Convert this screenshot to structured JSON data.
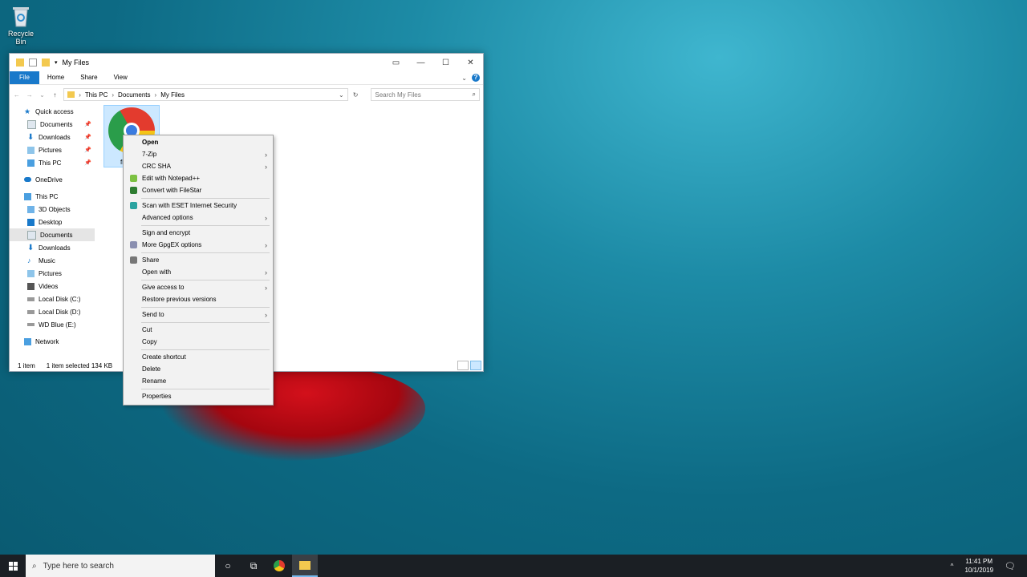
{
  "desktop": {
    "recycle_bin_label": "Recycle Bin"
  },
  "window": {
    "title": "My Files",
    "ribbon_tabs": [
      "File",
      "Home",
      "Share",
      "View"
    ],
    "breadcrumb": [
      "This PC",
      "Documents",
      "My Files"
    ],
    "search_placeholder": "Search My Files",
    "nav": [
      {
        "label": "Quick access",
        "icon": "star-icon",
        "level": 0
      },
      {
        "label": "Documents",
        "icon": "documents-icon",
        "level": 1,
        "pinned": true
      },
      {
        "label": "Downloads",
        "icon": "download-icon",
        "level": 1,
        "pinned": true
      },
      {
        "label": "Pictures",
        "icon": "pictures-icon",
        "level": 1,
        "pinned": true
      },
      {
        "label": "This PC",
        "icon": "computer-icon",
        "level": 1,
        "pinned": true
      },
      {
        "label": "OneDrive",
        "icon": "cloud-icon",
        "level": 0
      },
      {
        "label": "This PC",
        "icon": "computer-icon",
        "level": 0
      },
      {
        "label": "3D Objects",
        "icon": "cube-icon",
        "level": 1
      },
      {
        "label": "Desktop",
        "icon": "desktop-icon",
        "level": 1
      },
      {
        "label": "Documents",
        "icon": "documents-icon",
        "level": 1,
        "selected": true
      },
      {
        "label": "Downloads",
        "icon": "download-icon",
        "level": 1
      },
      {
        "label": "Music",
        "icon": "music-icon",
        "level": 1
      },
      {
        "label": "Pictures",
        "icon": "pictures-icon",
        "level": 1
      },
      {
        "label": "Videos",
        "icon": "video-icon",
        "level": 1
      },
      {
        "label": "Local Disk (C:)",
        "icon": "drive-icon",
        "level": 1
      },
      {
        "label": "Local Disk (D:)",
        "icon": "drive-icon",
        "level": 1
      },
      {
        "label": "WD Blue (E:)",
        "icon": "drive-icon",
        "level": 1
      },
      {
        "label": "Network",
        "icon": "network-icon",
        "level": 0
      }
    ],
    "file": {
      "name": "fi"
    },
    "status": {
      "items": "1 item",
      "selected": "1 item selected  134 KB"
    }
  },
  "context_menu": {
    "items": [
      {
        "label": "Open",
        "bold": true
      },
      {
        "label": "7-Zip",
        "submenu": true
      },
      {
        "label": "CRC SHA",
        "submenu": true
      },
      {
        "label": "Edit with Notepad++",
        "icon": "notepadpp-icon"
      },
      {
        "label": "Convert with FileStar",
        "icon": "filestar-icon"
      },
      {
        "sep": true
      },
      {
        "label": "Scan with ESET Internet Security",
        "icon": "eset-icon"
      },
      {
        "label": "Advanced options",
        "submenu": true
      },
      {
        "sep": true
      },
      {
        "label": "Sign and encrypt"
      },
      {
        "label": "More GpgEX options",
        "icon": "lock-icon",
        "submenu": true
      },
      {
        "sep": true
      },
      {
        "label": "Share",
        "icon": "share-icon"
      },
      {
        "label": "Open with",
        "submenu": true
      },
      {
        "sep": true
      },
      {
        "label": "Give access to",
        "submenu": true
      },
      {
        "label": "Restore previous versions"
      },
      {
        "sep": true
      },
      {
        "label": "Send to",
        "submenu": true
      },
      {
        "sep": true
      },
      {
        "label": "Cut"
      },
      {
        "label": "Copy"
      },
      {
        "sep": true
      },
      {
        "label": "Create shortcut"
      },
      {
        "label": "Delete"
      },
      {
        "label": "Rename"
      },
      {
        "sep": true
      },
      {
        "label": "Properties"
      }
    ]
  },
  "taskbar": {
    "search_placeholder": "Type here to search",
    "time": "11:41 PM",
    "date": "10/1/2019"
  },
  "colors": {
    "accent": "#1979ca",
    "selection": "#cce8ff"
  }
}
